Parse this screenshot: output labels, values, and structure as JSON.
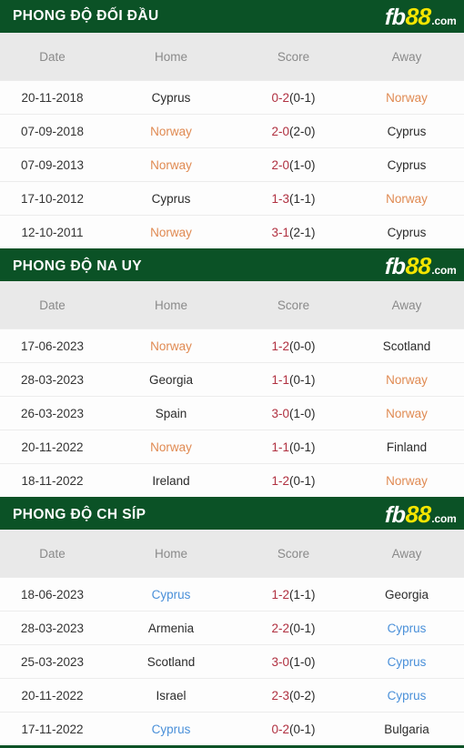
{
  "logo": {
    "part1": "fb",
    "part2": "88",
    "part3": ".com",
    "yellow": "#f5e500",
    "green": "#0b5226"
  },
  "colors": {
    "header_green": "#0b5226",
    "logo_yellow": "#f5e500",
    "highlight_orange": "#e08a52",
    "highlight_blue": "#4a90d9",
    "score_red": "#b03040",
    "thead_bg": "#e9e9e9",
    "thead_text": "#8a8a8a"
  },
  "columns": {
    "date": "Date",
    "home": "Home",
    "score": "Score",
    "away": "Away"
  },
  "sections": [
    {
      "title": "PHONG ĐỘ ĐỐI ĐẦU",
      "rows": [
        {
          "date": "20-11-2018",
          "home": "Cyprus",
          "home_style": "plain",
          "score_main": "0-2",
          "score_ht": "(0-1)",
          "away": "Norway",
          "away_style": "orange"
        },
        {
          "date": "07-09-2018",
          "home": "Norway",
          "home_style": "orange",
          "score_main": "2-0",
          "score_ht": "(2-0)",
          "away": "Cyprus",
          "away_style": "plain"
        },
        {
          "date": "07-09-2013",
          "home": "Norway",
          "home_style": "orange",
          "score_main": "2-0",
          "score_ht": "(1-0)",
          "away": "Cyprus",
          "away_style": "plain"
        },
        {
          "date": "17-10-2012",
          "home": "Cyprus",
          "home_style": "plain",
          "score_main": "1-3",
          "score_ht": "(1-1)",
          "away": "Norway",
          "away_style": "orange"
        },
        {
          "date": "12-10-2011",
          "home": "Norway",
          "home_style": "orange",
          "score_main": "3-1",
          "score_ht": "(2-1)",
          "away": "Cyprus",
          "away_style": "plain"
        }
      ]
    },
    {
      "title": "PHONG ĐỘ NA UY",
      "rows": [
        {
          "date": "17-06-2023",
          "home": "Norway",
          "home_style": "orange",
          "score_main": "1-2",
          "score_ht": "(0-0)",
          "away": "Scotland",
          "away_style": "plain"
        },
        {
          "date": "28-03-2023",
          "home": "Georgia",
          "home_style": "plain",
          "score_main": "1-1",
          "score_ht": "(0-1)",
          "away": "Norway",
          "away_style": "orange"
        },
        {
          "date": "26-03-2023",
          "home": "Spain",
          "home_style": "plain",
          "score_main": "3-0",
          "score_ht": "(1-0)",
          "away": "Norway",
          "away_style": "orange"
        },
        {
          "date": "20-11-2022",
          "home": "Norway",
          "home_style": "orange",
          "score_main": "1-1",
          "score_ht": "(0-1)",
          "away": "Finland",
          "away_style": "plain"
        },
        {
          "date": "18-11-2022",
          "home": "Ireland",
          "home_style": "plain",
          "score_main": "1-2",
          "score_ht": "(0-1)",
          "away": "Norway",
          "away_style": "orange"
        }
      ]
    },
    {
      "title": "PHONG ĐỘ CH SÍP",
      "rows": [
        {
          "date": "18-06-2023",
          "home": "Cyprus",
          "home_style": "blue",
          "score_main": "1-2",
          "score_ht": "(1-1)",
          "away": "Georgia",
          "away_style": "plain"
        },
        {
          "date": "28-03-2023",
          "home": "Armenia",
          "home_style": "plain",
          "score_main": "2-2",
          "score_ht": "(0-1)",
          "away": "Cyprus",
          "away_style": "blue"
        },
        {
          "date": "25-03-2023",
          "home": "Scotland",
          "home_style": "plain",
          "score_main": "3-0",
          "score_ht": "(1-0)",
          "away": "Cyprus",
          "away_style": "blue"
        },
        {
          "date": "20-11-2022",
          "home": "Israel",
          "home_style": "plain",
          "score_main": "2-3",
          "score_ht": "(0-2)",
          "away": "Cyprus",
          "away_style": "blue"
        },
        {
          "date": "17-11-2022",
          "home": "Cyprus",
          "home_style": "blue",
          "score_main": "0-2",
          "score_ht": "(0-1)",
          "away": "Bulgaria",
          "away_style": "plain"
        }
      ]
    }
  ]
}
